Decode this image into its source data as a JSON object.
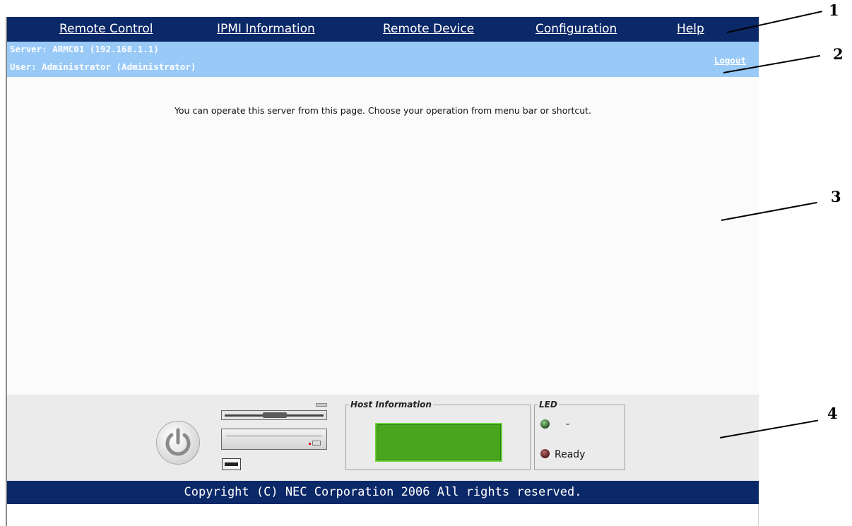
{
  "menu": {
    "items": [
      "Remote Control",
      "IPMI Information",
      "Remote Device",
      "Configuration",
      "Help"
    ]
  },
  "info": {
    "server": "Server: ARMC01 (192.168.1.1)",
    "user": "User: Administrator (Administrator)",
    "logout": "Logout"
  },
  "main": {
    "message": "You can operate this server from this page. Choose your operation from menu bar or shortcut."
  },
  "panel": {
    "host_info_label": "Host Information",
    "led_label": "LED",
    "led1_text": "-",
    "led2_text": "Ready"
  },
  "footer": {
    "copyright": "Copyright (C) NEC Corporation 2006 All rights reserved."
  },
  "annotations": [
    "1",
    "2",
    "3",
    "4"
  ],
  "colors": {
    "nav_bg": "#0b2868",
    "info_bg": "#99c9f7",
    "lcd_green": "#4aa51e",
    "led_green": "#2f5a2a",
    "led_red": "#5a1e1e"
  }
}
